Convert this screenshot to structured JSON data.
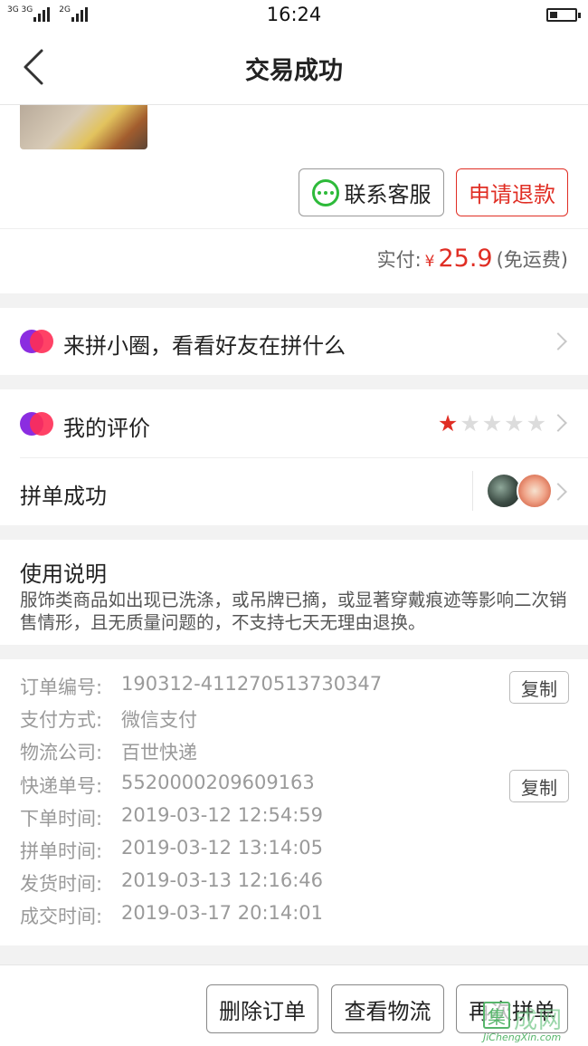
{
  "status": {
    "network1": "3G 3G",
    "network2": "2G",
    "time": "16:24",
    "battery_level": 0.3
  },
  "nav": {
    "title": "交易成功",
    "back_icon": "chevron-left-icon"
  },
  "actions": {
    "contact": "联系客服",
    "refund": "申请退款"
  },
  "payment": {
    "label": "实付:",
    "currency": "¥",
    "amount": "25.9",
    "note": "(免运费)"
  },
  "circle": {
    "label": "来拼小圈，看看好友在拼什么"
  },
  "review": {
    "label": "我的评价",
    "rating": 1,
    "max": 5
  },
  "group": {
    "label": "拼单成功"
  },
  "usage": {
    "title": "使用说明",
    "text": "服饰类商品如出现已洗涤，或吊牌已摘，或显著穿戴痕迹等影响二次销售情形，且无质量问题的，不支持七天无理由退换。"
  },
  "order": {
    "copy_label": "复制",
    "fields": [
      {
        "key": "订单编号:",
        "value": "190312-411270513730347"
      },
      {
        "key": "支付方式:",
        "value": "微信支付"
      },
      {
        "key": "物流公司:",
        "value": "百世快递"
      },
      {
        "key": "快递单号:",
        "value": "5520000209609163"
      },
      {
        "key": "下单时间:",
        "value": "2019-03-12 12:54:59"
      },
      {
        "key": "拼单时间:",
        "value": "2019-03-12 13:14:05"
      },
      {
        "key": "发货时间:",
        "value": "2019-03-13 12:16:46"
      },
      {
        "key": "成交时间:",
        "value": "2019-03-17 20:14:01"
      }
    ]
  },
  "bottom": {
    "delete": "删除订单",
    "logistics": "查看物流",
    "again": "再次拼单"
  },
  "watermark": {
    "mark": "集",
    "cn": "成网",
    "en": "JiChengXin.com"
  },
  "colors": {
    "accent": "#e02e24",
    "wechat_green": "#2dba3a",
    "logo_purple": "#8b2de0",
    "logo_pink": "#ff2d55"
  }
}
